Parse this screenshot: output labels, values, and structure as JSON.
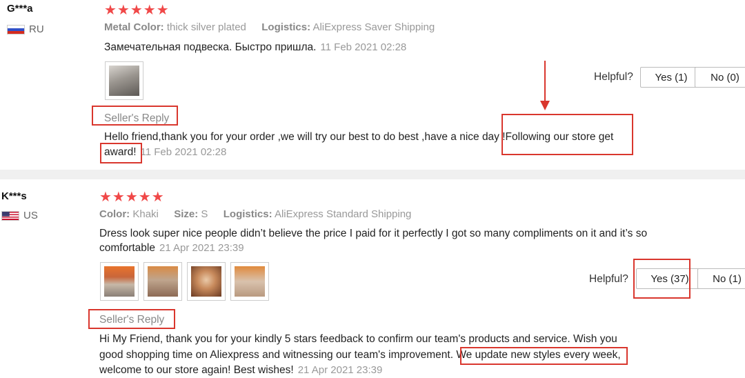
{
  "review1": {
    "user": "G***a",
    "country": "RU",
    "stars": "★★★★★",
    "meta": [
      {
        "label": "Metal Color:",
        "value": "thick silver plated"
      },
      {
        "label": "Logistics:",
        "value": "AliExpress Saver Shipping"
      }
    ],
    "text": "Замечательная подвеска. Быстро пришла.",
    "date": "11 Feb 2021 02:28",
    "helpful_label": "Helpful?",
    "yes_label": "Yes (1)",
    "no_label": "No (0)",
    "reply_title": "Seller's Reply",
    "reply_line1": "Hello friend,thank you for your order ,we will try our best to do best ,have a nice day !Following our store get",
    "reply_line2_a": "award!",
    "reply_date": "11 Feb 2021 02:28"
  },
  "review2": {
    "user": "K***s",
    "country": "US",
    "stars": "★★★★★",
    "meta": [
      {
        "label": "Color:",
        "value": "Khaki"
      },
      {
        "label": "Size:",
        "value": "S"
      },
      {
        "label": "Logistics:",
        "value": "AliExpress Standard Shipping"
      }
    ],
    "text_line1": "Dress look super nice people didn’t believe the price I paid for it perfectly I got so many compliments on it and it’s so",
    "text_line2": "comfortable",
    "date": "21 Apr 2021 23:39",
    "helpful_label": "Helpful?",
    "yes_label": "Yes (37)",
    "no_label": "No (1)",
    "reply_title": "Seller's Reply",
    "reply_line1": "Hi My Friend, thank you for your kindly 5 stars feedback to confirm our team's products and service. Wish you",
    "reply_line2_a": "good shopping time on Aliexpress and witnessing our team's improvement.",
    "reply_line2_b": "We update new styles every week,",
    "reply_line3": "welcome to our store again! Best wishes!",
    "reply_date": "21 Apr 2021 23:39"
  },
  "colors": {
    "star": "#f04848",
    "highlight_box": "#d9362d"
  }
}
